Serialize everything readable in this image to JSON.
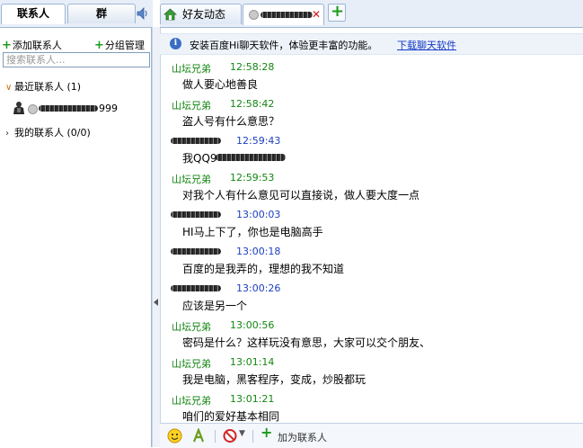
{
  "left_panel": {
    "tabs": [
      {
        "label": "联系人"
      },
      {
        "label": "群"
      }
    ],
    "add_contact": "添加联系人",
    "group_manage": "分组管理",
    "search_placeholder": "搜索联系人...",
    "groups": [
      {
        "label": "最近联系人 (1)",
        "expanded": true
      },
      {
        "label": "我的联系人 (0/0)",
        "expanded": false
      }
    ],
    "recent_contact": {
      "name_visible_suffix": "999"
    }
  },
  "right_panel": {
    "tabs": [
      {
        "label": "好友动态"
      }
    ],
    "notice": {
      "text": "安装百度Hi聊天软件，体验更丰富的功能。",
      "link": "下载聊天软件"
    },
    "messages": [
      {
        "sender": "山坛兄弟",
        "time": "12:58:28",
        "body": "做人要心地善良",
        "self": true
      },
      {
        "sender": "山坛兄弟",
        "time": "12:58:42",
        "body": "盗人号有什么意思？",
        "self": true
      },
      {
        "sender": "",
        "time": "12:59:43",
        "body": "我QQ9",
        "self": false
      },
      {
        "sender": "山坛兄弟",
        "time": "12:59:53",
        "body": "对我个人有什么意见可以直接说，做人要大度一点",
        "self": true
      },
      {
        "sender": "",
        "time": "13:00:03",
        "body": "HI马上下了，你也是电脑高手",
        "self": false
      },
      {
        "sender": "",
        "time": "13:00:18",
        "body": "百度的是我弄的，理想的我不知道",
        "self": false
      },
      {
        "sender": "",
        "time": "13:00:26",
        "body": "应该是另一个",
        "self": false
      },
      {
        "sender": "山坛兄弟",
        "time": "13:00:56",
        "body": "密码是什么？这样玩没有意思，大家可以交个朋友、",
        "self": true
      },
      {
        "sender": "山坛兄弟",
        "time": "13:01:14",
        "body": "我是电脑，黑客程序，变成，炒股都玩",
        "self": true
      },
      {
        "sender": "山坛兄弟",
        "time": "13:01:21",
        "body": "咱们的爱好基本相同",
        "self": true
      }
    ],
    "toolbar": {
      "add_contact": "加为联系人"
    }
  },
  "colors": {
    "self_name": "#128612",
    "other_time": "#1c3fc0",
    "link": "#1238c4",
    "close": "#d21a1a"
  }
}
